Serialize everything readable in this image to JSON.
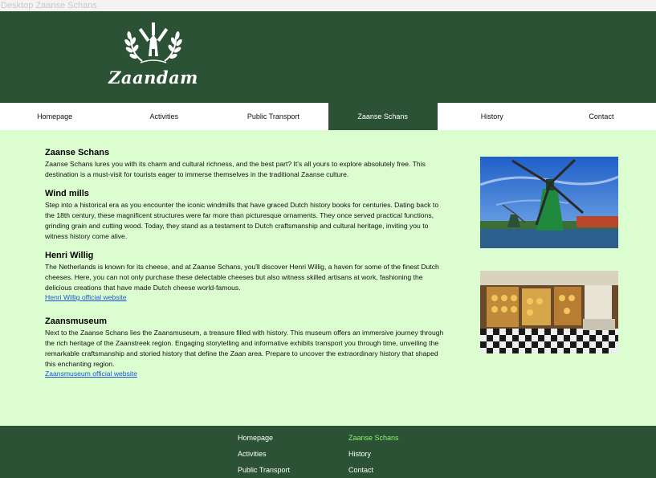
{
  "window": {
    "title": "Desktop Zaanse Schans"
  },
  "header": {
    "logo_text": "Zaandam",
    "colors": {
      "header_bg": "#2b5234",
      "page_bg": "#dcfdd0",
      "active_footer_link": "#8cf26b"
    }
  },
  "nav": {
    "items": [
      {
        "label": "Homepage",
        "active": false
      },
      {
        "label": "Activities",
        "active": false
      },
      {
        "label": "Public Transport",
        "active": false
      },
      {
        "label": "Zaanse Schans",
        "active": true
      },
      {
        "label": "History",
        "active": false
      },
      {
        "label": "Contact",
        "active": false
      }
    ]
  },
  "main": {
    "sections": [
      {
        "title": "Zaanse Schans",
        "text": "Zaanse Schans lures you with its charm and cultural richness, and the best part? It's all yours to explore absolutely free. This destination is a must-visit for tourists eager to immerse themselves in the traditional Zaanse culture."
      },
      {
        "title": "Wind mills",
        "text": "Step into a historical era as you encounter the iconic windmills that have graced Dutch history books for centuries. Dating back to the 18th century, these magnificent structures were far more than picturesque ornaments. They once served practical functions, grinding grain and cutting wood. Today, they stand as a testament to Dutch craftsmanship and cultural heritage, inviting you to witness history come alive."
      },
      {
        "title": "Henri Willig",
        "text": "The Netherlands is known for its cheese, and at Zaanse Schans, you'll discover Henri Willig, a haven for some of the finest Dutch cheeses. Here, you can not only purchase these delectable cheeses but also witness skilled artisans at work, fashioning the delicious creations that have made Dutch cheese world-famous.",
        "link": "Henri Willig official website"
      },
      {
        "title": "Zaansmuseum",
        "text": "Next to the Zaanse Schans lies the Zaansmuseum, a treasure filled with history. This museum offers an immersive journey through the rich heritage of the Zaanstreek region. Engaging storytelling and informative exhibits transport you through time, unveiling the remarkable craftsmanship and storied history that define the Zaan area. Prepare to uncover the extraordinary history that shaped this enchanting region.",
        "link": "Zaansmuseum official website"
      }
    ]
  },
  "footer": {
    "links": [
      {
        "label": "Homepage",
        "active": false
      },
      {
        "label": "Zaanse Schans",
        "active": true
      },
      {
        "label": "Activities",
        "active": false
      },
      {
        "label": "History",
        "active": false
      },
      {
        "label": "Public Transport",
        "active": false
      },
      {
        "label": "Contact",
        "active": false
      }
    ]
  }
}
